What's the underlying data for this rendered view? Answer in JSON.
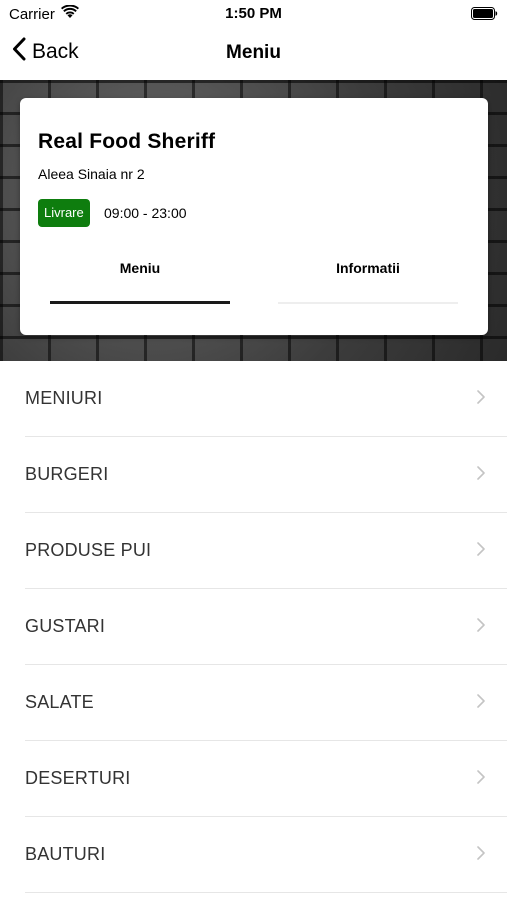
{
  "status_bar": {
    "carrier": "Carrier",
    "time": "1:50 PM"
  },
  "nav": {
    "back_label": "Back",
    "title": "Meniu"
  },
  "restaurant": {
    "name": "Real Food Sheriff",
    "address": "Aleea Sinaia nr 2",
    "delivery_badge": "Livrare",
    "delivery_color": "#0e7d0e",
    "hours": "09:00 - 23:00"
  },
  "tabs": [
    {
      "label": "Meniu",
      "active": true
    },
    {
      "label": "Informatii",
      "active": false
    }
  ],
  "categories": [
    {
      "label": "MENIURI"
    },
    {
      "label": "BURGERI"
    },
    {
      "label": "PRODUSE PUI"
    },
    {
      "label": "GUSTARI"
    },
    {
      "label": "SALATE"
    },
    {
      "label": "DESERTURI"
    },
    {
      "label": "BAUTURI"
    }
  ],
  "icons": {
    "wifi": "wifi-icon",
    "battery": "battery-icon",
    "back": "chevron-left-icon",
    "row": "chevron-right-icon"
  }
}
